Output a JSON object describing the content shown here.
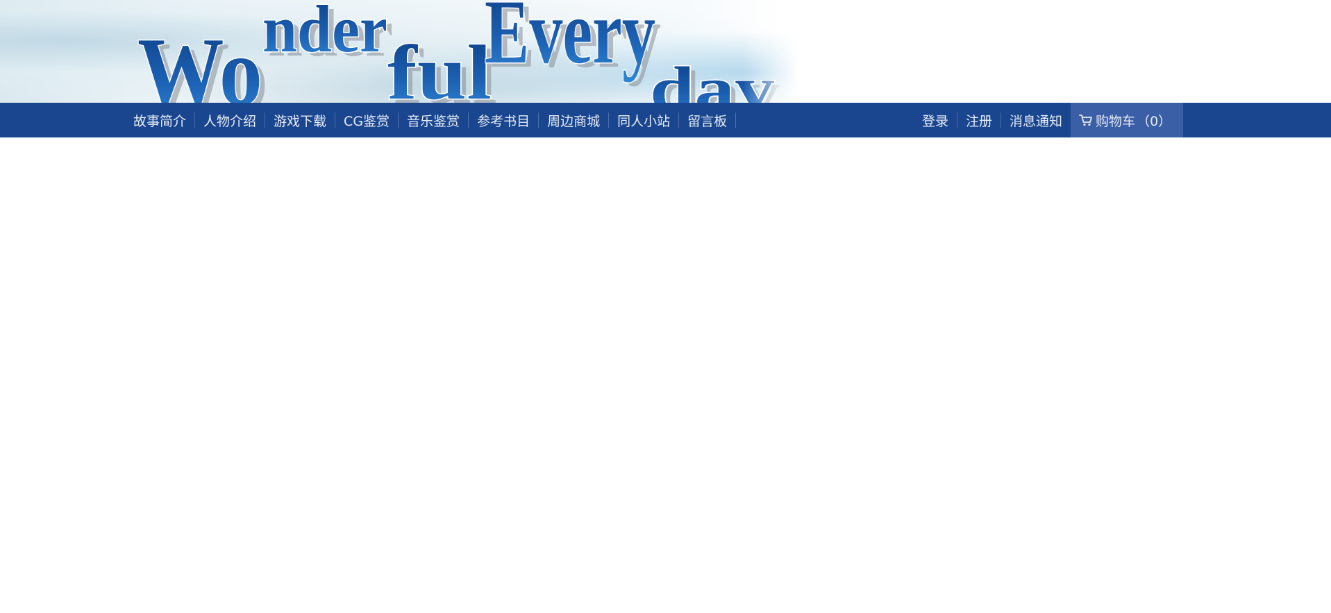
{
  "banner": {
    "logo_text": "WonderfulEveryday",
    "logo_words": [
      "Wo",
      "nder",
      "ful",
      "Every",
      "day"
    ],
    "colors": {
      "logo_blue": "#1b5eb0",
      "logo_dark": "#0d3f86",
      "logo_shadow": "#8a8f96"
    }
  },
  "nav": {
    "left_items": [
      {
        "label": "故事简介"
      },
      {
        "label": "人物介绍"
      },
      {
        "label": "游戏下载"
      },
      {
        "label": "CG鉴赏"
      },
      {
        "label": "音乐鉴赏"
      },
      {
        "label": "参考书目"
      },
      {
        "label": "周边商城"
      },
      {
        "label": "同人小站"
      },
      {
        "label": "留言板"
      }
    ],
    "right_items": [
      {
        "label": "登录"
      },
      {
        "label": "注册"
      },
      {
        "label": "消息通知"
      }
    ],
    "cart": {
      "icon": "cart-icon",
      "label": "购物车",
      "count": "（0）"
    },
    "colors": {
      "bar": "#1a468f",
      "cart_bg": "#3a5fa6",
      "text": "#e6ecf6",
      "separator": "#4a6fac"
    }
  }
}
